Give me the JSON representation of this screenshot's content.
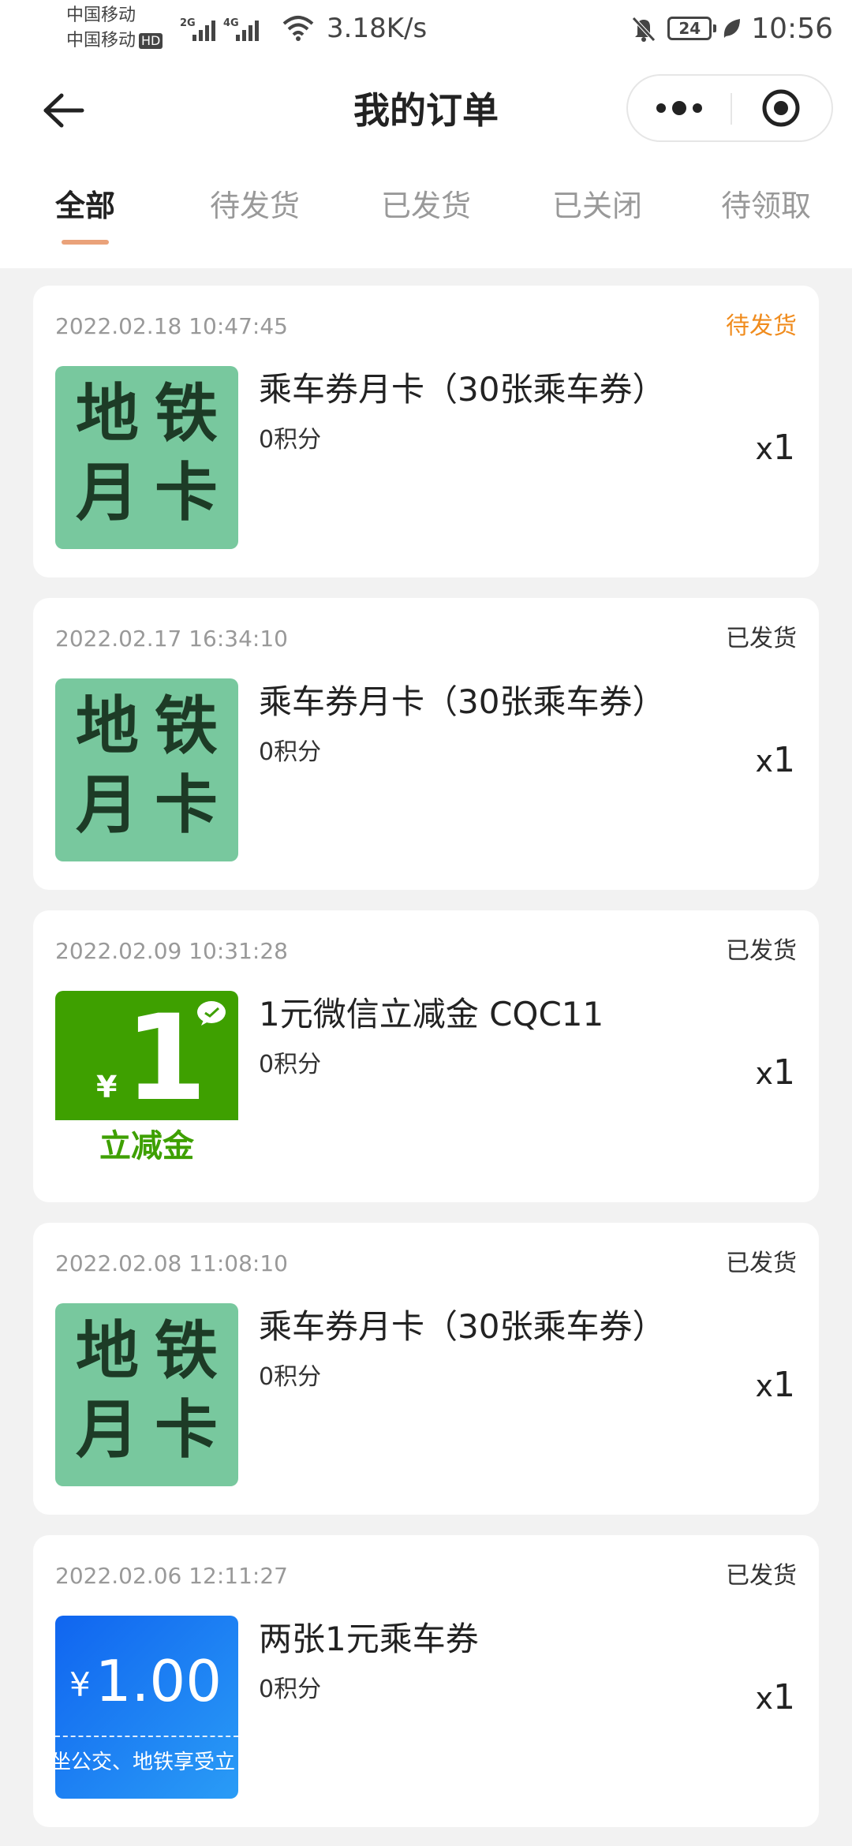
{
  "status_bar": {
    "carrier_1": "中国移动",
    "carrier_2": "中国移动",
    "hd_badge": "HD",
    "network_1": "2G",
    "network_2": "4G",
    "speed": "3.18K/s",
    "battery": "24",
    "time": "10:56"
  },
  "header": {
    "title": "我的订单"
  },
  "tabs": [
    {
      "label": "全部",
      "active": true
    },
    {
      "label": "待发货",
      "active": false
    },
    {
      "label": "已发货",
      "active": false
    },
    {
      "label": "已关闭",
      "active": false
    },
    {
      "label": "待领取",
      "active": false
    }
  ],
  "orders": [
    {
      "date": "2022.02.18 10:47:45",
      "status": "待发货",
      "name": "乘车券月卡（30张乘车券）",
      "points": "0积分",
      "qty_prefix": "x",
      "qty": "1",
      "thumb": {
        "type": "metro",
        "chars": [
          "地",
          "铁",
          "月",
          "卡"
        ]
      }
    },
    {
      "date": "2022.02.17 16:34:10",
      "status": "已发货",
      "name": "乘车券月卡（30张乘车券）",
      "points": "0积分",
      "qty_prefix": "x",
      "qty": "1",
      "thumb": {
        "type": "metro",
        "chars": [
          "地",
          "铁",
          "月",
          "卡"
        ]
      }
    },
    {
      "date": "2022.02.09 10:31:28",
      "status": "已发货",
      "name": "1元微信立减金 CQC11",
      "points": "0积分",
      "qty_prefix": "x",
      "qty": "1",
      "thumb": {
        "type": "wechat",
        "yen": "¥",
        "amount": "1",
        "label": "立减金"
      }
    },
    {
      "date": "2022.02.08 11:08:10",
      "status": "已发货",
      "name": "乘车券月卡（30张乘车券）",
      "points": "0积分",
      "qty_prefix": "x",
      "qty": "1",
      "thumb": {
        "type": "metro",
        "chars": [
          "地",
          "铁",
          "月",
          "卡"
        ]
      }
    },
    {
      "date": "2022.02.06 12:11:27",
      "status": "已发货",
      "name": "两张1元乘车券",
      "points": "0积分",
      "qty_prefix": "x",
      "qty": "1",
      "thumb": {
        "type": "bus",
        "yen": "¥",
        "amount": "1.00",
        "sub": "坐公交、地铁享受立"
      }
    }
  ],
  "colors": {
    "pending_status": "#f08c1e",
    "tab_underline": "#eaa27a",
    "metro_bg": "#78c89e",
    "wechat_green": "#3ea000",
    "bus_blue": "#1065f0"
  },
  "icons": {
    "back": "arrow-left-icon",
    "more": "more-dots-icon",
    "close": "target-circle-icon"
  }
}
